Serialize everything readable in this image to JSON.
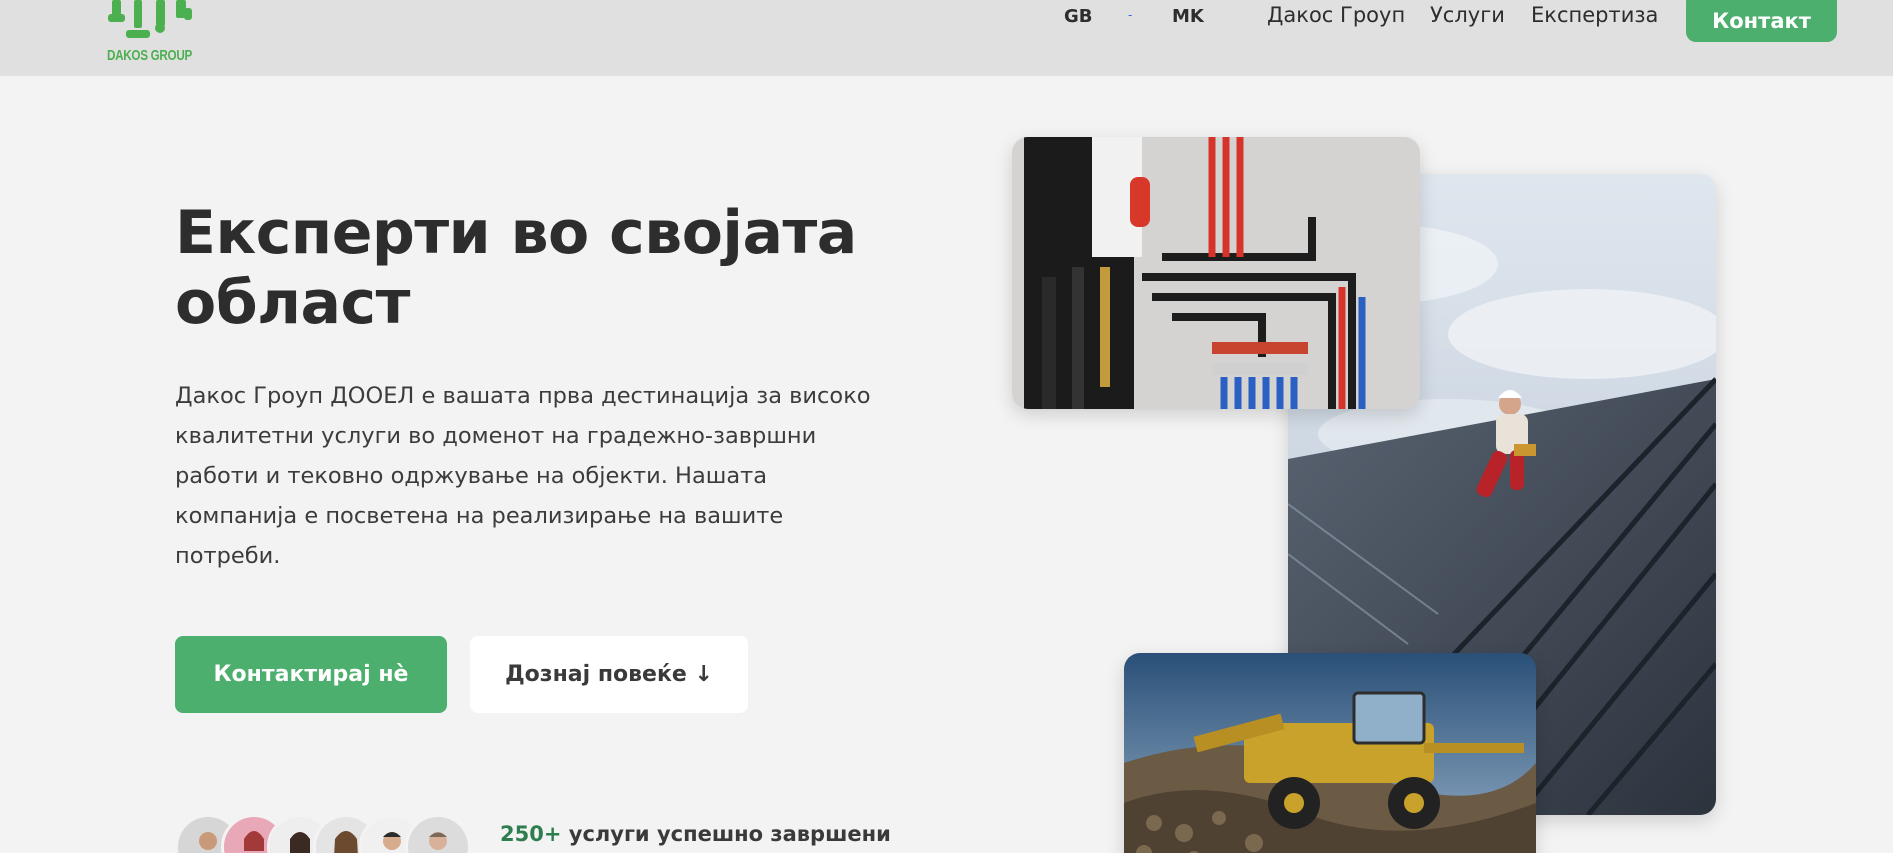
{
  "header": {
    "logo_text": "DAKOS GROUP",
    "lang_gb": "GB",
    "lang_separator": "-",
    "lang_mk": "MK",
    "nav": [
      "Дакос Гроуп",
      "Услуги",
      "Експертиза"
    ],
    "contact_label": "Контакт"
  },
  "hero": {
    "title": "Експерти во својата област",
    "description": "Дакос Гроуп ДООЕЛ е вашата прва дестинација за високо квалитетни услуги во доменот на градежно-завршни работи и тековно одржување на објекти. Нашата компанија е посветена на реализирање на вашите потреби.",
    "primary_button": "Контактирај нè",
    "secondary_button": "Дознај повеќе ↓"
  },
  "social_proof": {
    "count": "250+",
    "text": " услуги успешно завршени"
  },
  "colors": {
    "brand_green": "#4caf6e",
    "header_bg": "#e0e0e0",
    "page_bg": "#f3f3f3",
    "text_dark": "#2d2d2d"
  },
  "icons": {
    "logo": "paint-roller-tools-logo",
    "images": [
      "plumbing-manifold-photo",
      "roof-worker-photo",
      "harvester-machine-photo"
    ]
  }
}
